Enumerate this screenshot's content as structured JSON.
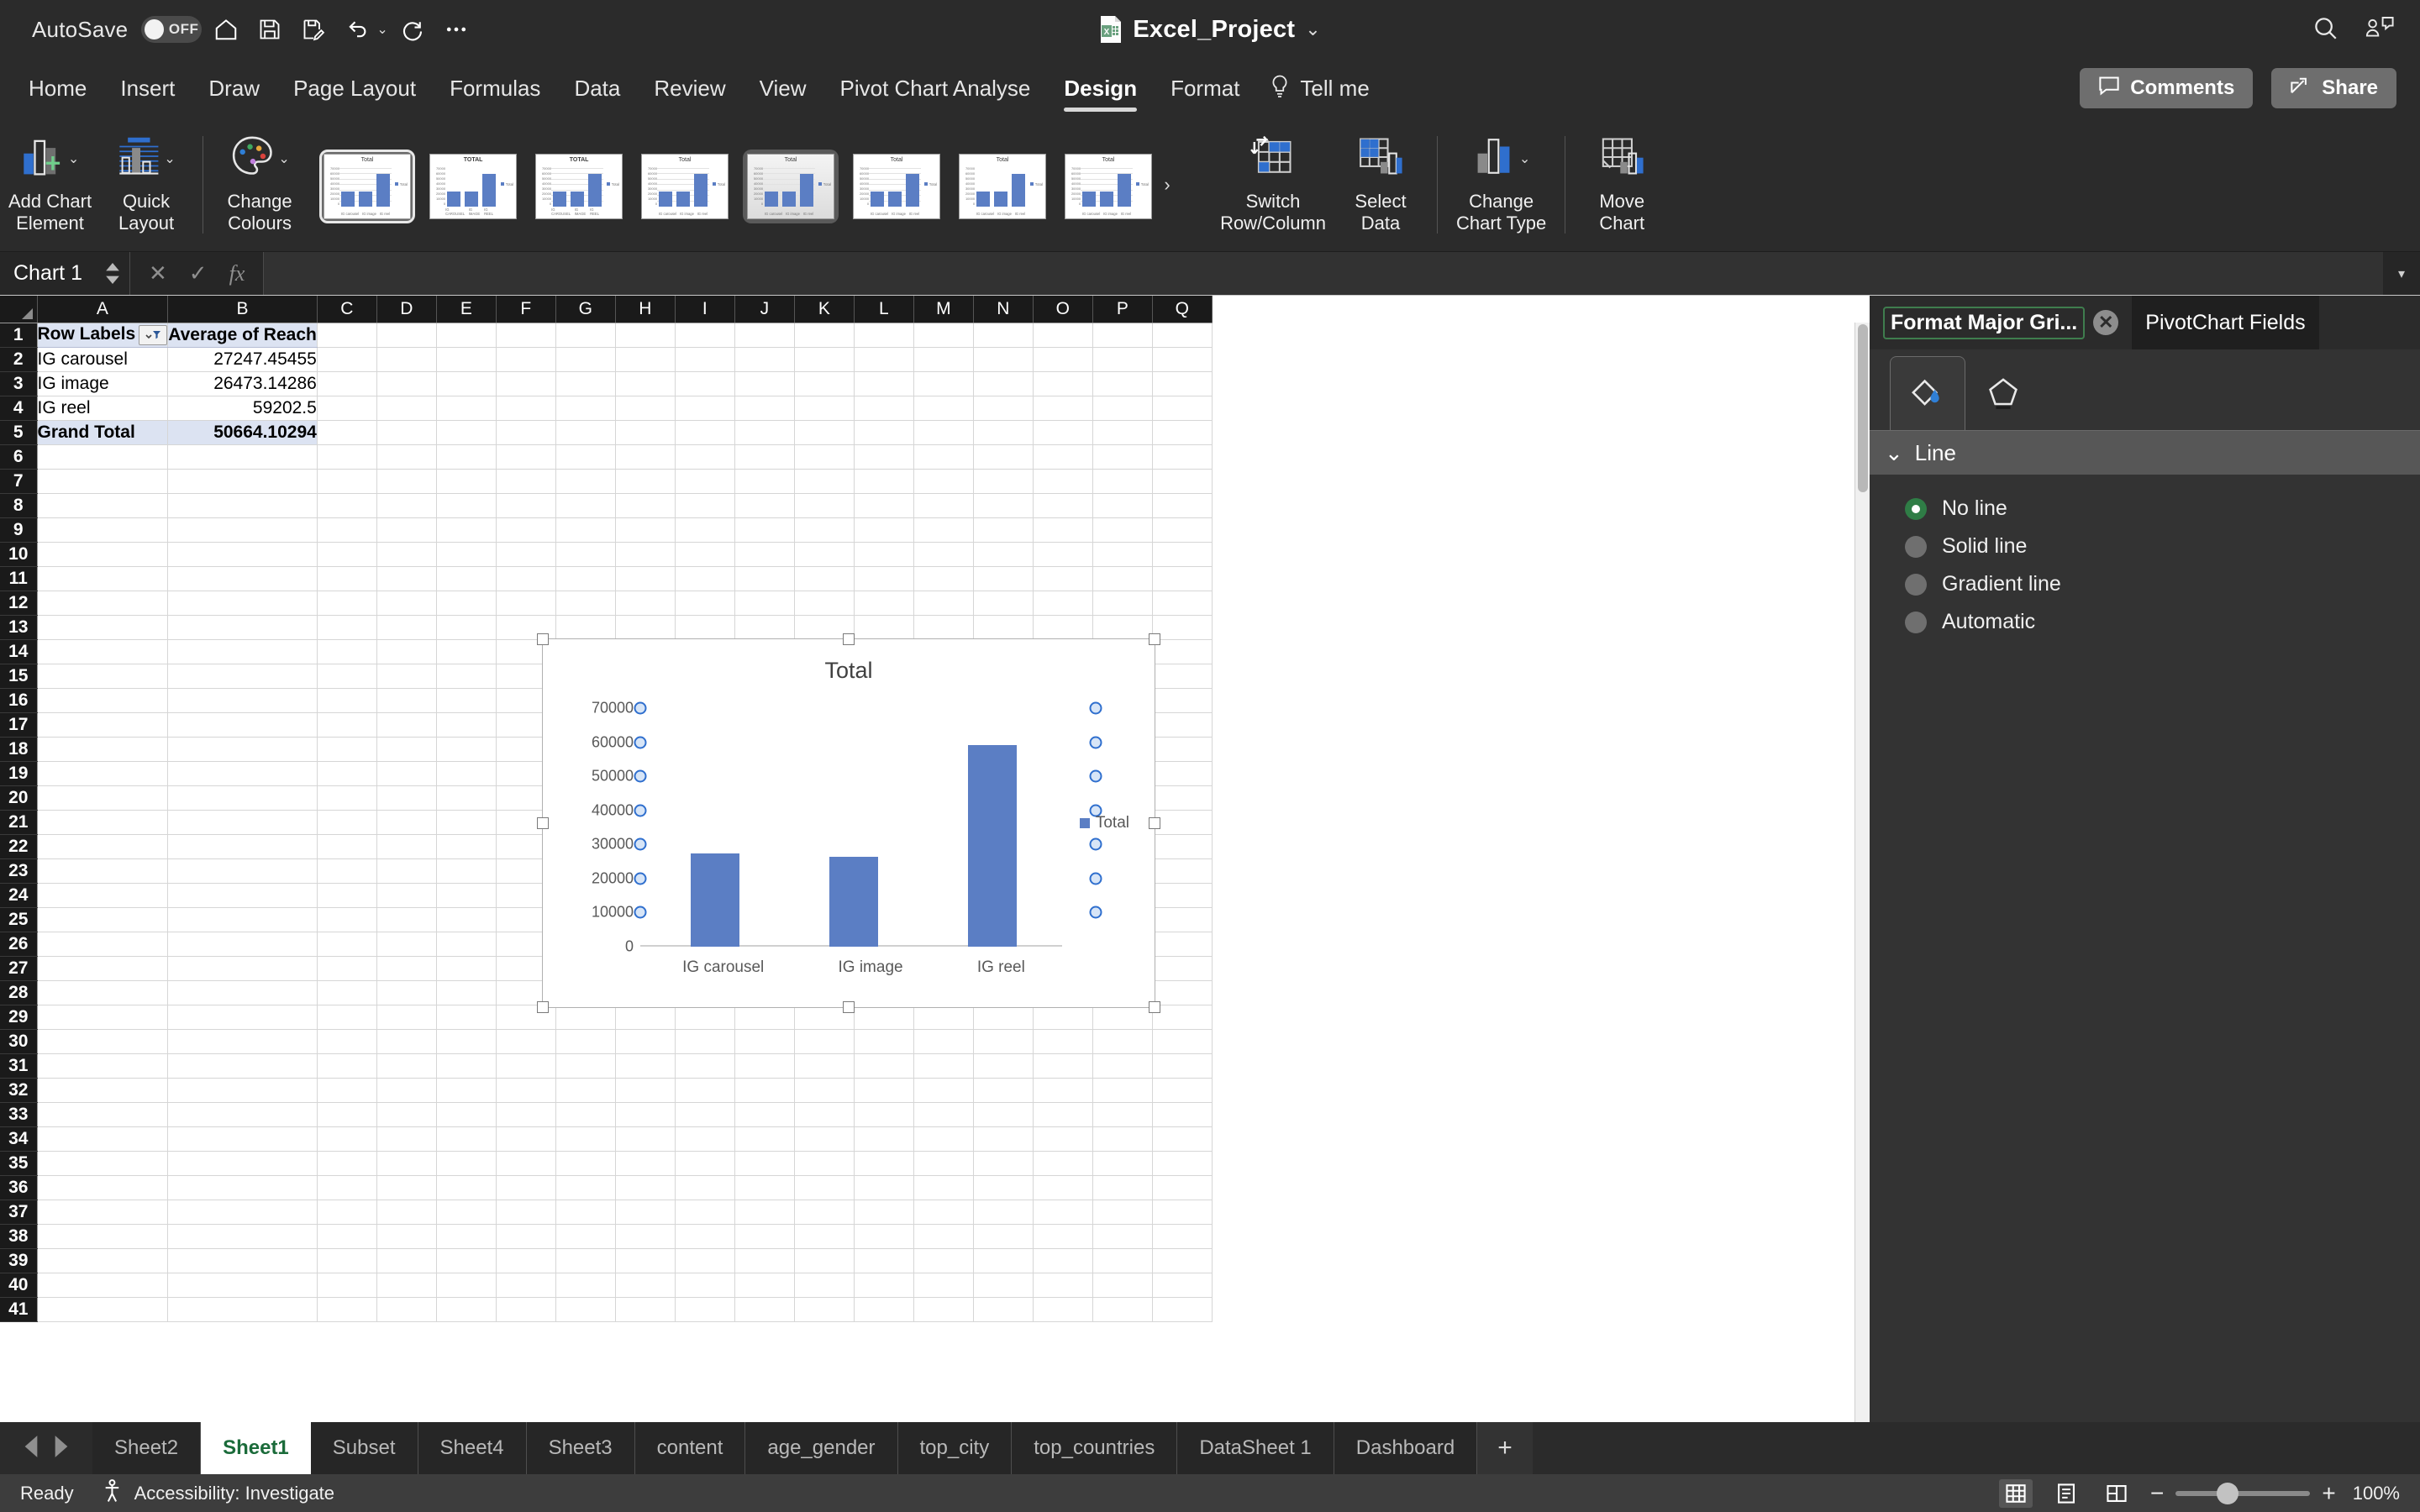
{
  "titlebar": {
    "autosave_label": "AutoSave",
    "autosave_state": "OFF",
    "doc_title": "Excel_Project",
    "quick_access": [
      "home-icon",
      "save-icon",
      "save-as-icon",
      "undo-icon",
      "redo-icon",
      "more-icon"
    ],
    "search_icon": "search-icon",
    "presence_icon": "people-chat-icon"
  },
  "ribbon_tabs": {
    "items": [
      {
        "label": "Home",
        "active": false
      },
      {
        "label": "Insert",
        "active": false
      },
      {
        "label": "Draw",
        "active": false
      },
      {
        "label": "Page Layout",
        "active": false
      },
      {
        "label": "Formulas",
        "active": false
      },
      {
        "label": "Data",
        "active": false
      },
      {
        "label": "Review",
        "active": false
      },
      {
        "label": "View",
        "active": false
      },
      {
        "label": "Pivot Chart Analyse",
        "active": false
      },
      {
        "label": "Design",
        "active": true
      },
      {
        "label": "Format",
        "active": false
      }
    ],
    "tell_me": "Tell me",
    "comments": "Comments",
    "share": "Share"
  },
  "ribbon": {
    "add_chart_element": "Add Chart\nElement",
    "add_chart_element_l1": "Add Chart",
    "add_chart_element_l2": "Element",
    "quick_layout_l1": "Quick",
    "quick_layout_l2": "Layout",
    "change_colours_l1": "Change",
    "change_colours_l2": "Colours",
    "switch_row_column_l1": "Switch",
    "switch_row_column_l2": "Row/Column",
    "select_data_l1": "Select",
    "select_data_l2": "Data",
    "change_chart_type_l1": "Change",
    "change_chart_type_l2": "Chart Type",
    "move_chart_l1": "Move",
    "move_chart_l2": "Chart",
    "gallery_more": "›",
    "gallery_styles": [
      {
        "name": "style-1",
        "selected": true,
        "title": "Total",
        "title_upper": false,
        "gridlines": true,
        "labels": false,
        "shaded": false
      },
      {
        "name": "style-2",
        "selected": false,
        "title": "TOTAL",
        "title_upper": true,
        "gridlines": false,
        "labels": true,
        "shaded": false
      },
      {
        "name": "style-3",
        "selected": false,
        "title": "TOTAL",
        "title_upper": true,
        "gridlines": true,
        "labels": false,
        "shaded": false
      },
      {
        "name": "style-4",
        "selected": false,
        "title": "Total",
        "title_upper": false,
        "gridlines": true,
        "labels": true,
        "shaded": false
      },
      {
        "name": "style-5",
        "selected": false,
        "title": "Total",
        "title_upper": false,
        "gridlines": true,
        "labels": true,
        "shaded": true
      },
      {
        "name": "style-6",
        "selected": false,
        "title": "Total",
        "title_upper": false,
        "gridlines": true,
        "labels": false,
        "shaded": false
      },
      {
        "name": "style-7",
        "selected": false,
        "title": "Total",
        "title_upper": false,
        "gridlines": false,
        "labels": false,
        "shaded": false
      },
      {
        "name": "style-8",
        "selected": false,
        "title": "Total",
        "title_upper": false,
        "gridlines": true,
        "labels": false,
        "shaded": false
      }
    ]
  },
  "formula_bar": {
    "name_box": "Chart 1",
    "cancel_icon": "cancel-icon",
    "enter_icon": "confirm-icon",
    "fx_icon": "fx-icon",
    "value": "",
    "expand_icon": "chevron-down-icon"
  },
  "sheet": {
    "columns": [
      "A",
      "B",
      "C",
      "D",
      "E",
      "F",
      "G",
      "H",
      "I",
      "J",
      "K",
      "L",
      "M",
      "N",
      "O",
      "P",
      "Q"
    ],
    "rows": [
      1,
      2,
      3,
      4,
      5,
      6,
      7,
      8,
      9,
      10,
      11,
      12,
      13,
      14,
      15,
      16,
      17,
      18,
      19,
      20,
      21,
      22,
      23,
      24,
      25,
      26,
      27,
      28,
      29,
      30,
      31,
      32,
      33,
      34,
      35,
      36,
      37,
      38,
      39,
      40,
      41
    ],
    "data": [
      {
        "row": 1,
        "a": "Row Labels",
        "b": "Average of Reach",
        "style": "header",
        "filter": true
      },
      {
        "row": 2,
        "a": "IG carousel",
        "b": "27247.45455",
        "style": "normal",
        "filter": false
      },
      {
        "row": 3,
        "a": "IG image",
        "b": "26473.14286",
        "style": "normal",
        "filter": false
      },
      {
        "row": 4,
        "a": "IG reel",
        "b": "59202.5",
        "style": "normal",
        "filter": false
      },
      {
        "row": 5,
        "a": "Grand Total",
        "b": "50664.10294",
        "style": "total",
        "filter": false
      }
    ]
  },
  "chart_data": {
    "type": "bar",
    "title": "Total",
    "categories": [
      "IG carousel",
      "IG image",
      "IG reel"
    ],
    "series": [
      {
        "name": "Total",
        "values": [
          27247.45455,
          26473.14286,
          59202.5
        ],
        "color": "#5b7ec4"
      }
    ],
    "xlabel": "",
    "ylabel": "",
    "ylim": [
      0,
      70000
    ],
    "yticks": [
      0,
      10000,
      20000,
      30000,
      40000,
      50000,
      60000,
      70000
    ],
    "ytick_labels": [
      "0",
      "10000",
      "20000",
      "30000",
      "40000",
      "50000",
      "60000",
      "70000"
    ],
    "grid": true,
    "gridlines_selected": true,
    "legend": {
      "entries": [
        "Total"
      ],
      "position": "right"
    },
    "selected": true
  },
  "format_pane": {
    "tab_title": "Format Major Gri...",
    "close_icon": "close-icon",
    "other_tab": "PivotChart Fields",
    "icon_tabs": [
      {
        "name": "fill-line-icon",
        "active": true
      },
      {
        "name": "effects-icon",
        "active": false
      }
    ],
    "section": {
      "label": "Line",
      "expanded": true,
      "options": [
        {
          "label": "No line",
          "selected": true
        },
        {
          "label": "Solid line",
          "selected": false
        },
        {
          "label": "Gradient line",
          "selected": false
        },
        {
          "label": "Automatic",
          "selected": false
        }
      ]
    },
    "accent_color": "#2f7d46"
  },
  "sheet_tabs": {
    "prev_icon": "prev-sheet-icon",
    "next_icon": "next-sheet-icon",
    "items": [
      {
        "label": "Sheet2",
        "active": false
      },
      {
        "label": "Sheet1",
        "active": true
      },
      {
        "label": "Subset",
        "active": false
      },
      {
        "label": "Sheet4",
        "active": false
      },
      {
        "label": "Sheet3",
        "active": false
      },
      {
        "label": "content",
        "active": false
      },
      {
        "label": "age_gender",
        "active": false
      },
      {
        "label": "top_city",
        "active": false
      },
      {
        "label": "top_countries",
        "active": false
      },
      {
        "label": "DataSheet 1",
        "active": false
      },
      {
        "label": "Dashboard",
        "active": false
      }
    ],
    "add_label": "+"
  },
  "status_bar": {
    "ready": "Ready",
    "accessibility": "Accessibility: Investigate",
    "accessibility_icon": "accessibility-icon",
    "views": [
      {
        "name": "normal-view-icon",
        "active": true
      },
      {
        "name": "page-layout-view-icon",
        "active": false
      },
      {
        "name": "page-break-view-icon",
        "active": false
      }
    ],
    "zoom_out": "−",
    "zoom_in": "+",
    "zoom_level": "100%"
  }
}
